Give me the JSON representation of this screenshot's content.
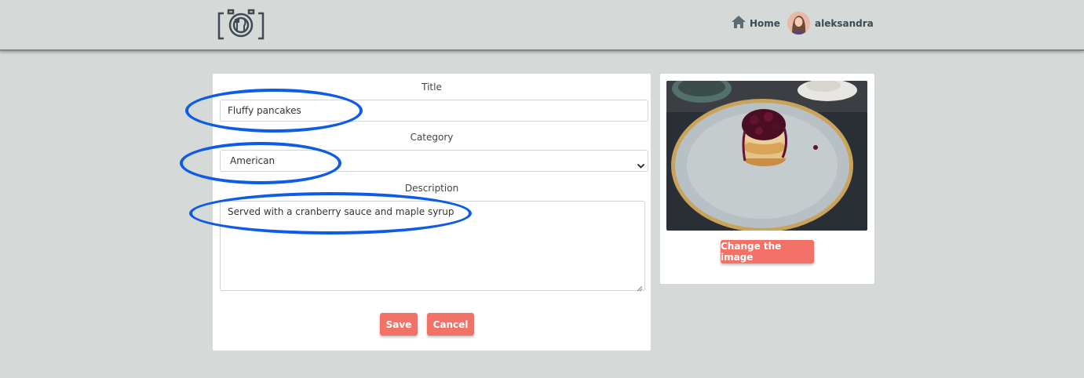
{
  "nav": {
    "logo": "logo-icon",
    "home_label": "Home",
    "username": "aleksandra"
  },
  "form": {
    "title_label": "Title",
    "title_value": "Fluffy pancakes",
    "category_label": "Category",
    "category_value": "American",
    "description_label": "Description",
    "description_value": "Served with a cranberry sauce and maple syrup",
    "save_label": "Save",
    "cancel_label": "Cancel"
  },
  "image_panel": {
    "change_label": "Change the image"
  },
  "colors": {
    "accent": "#f27267",
    "annotation": "#0d5ce8",
    "background": "#d5d9d8"
  }
}
